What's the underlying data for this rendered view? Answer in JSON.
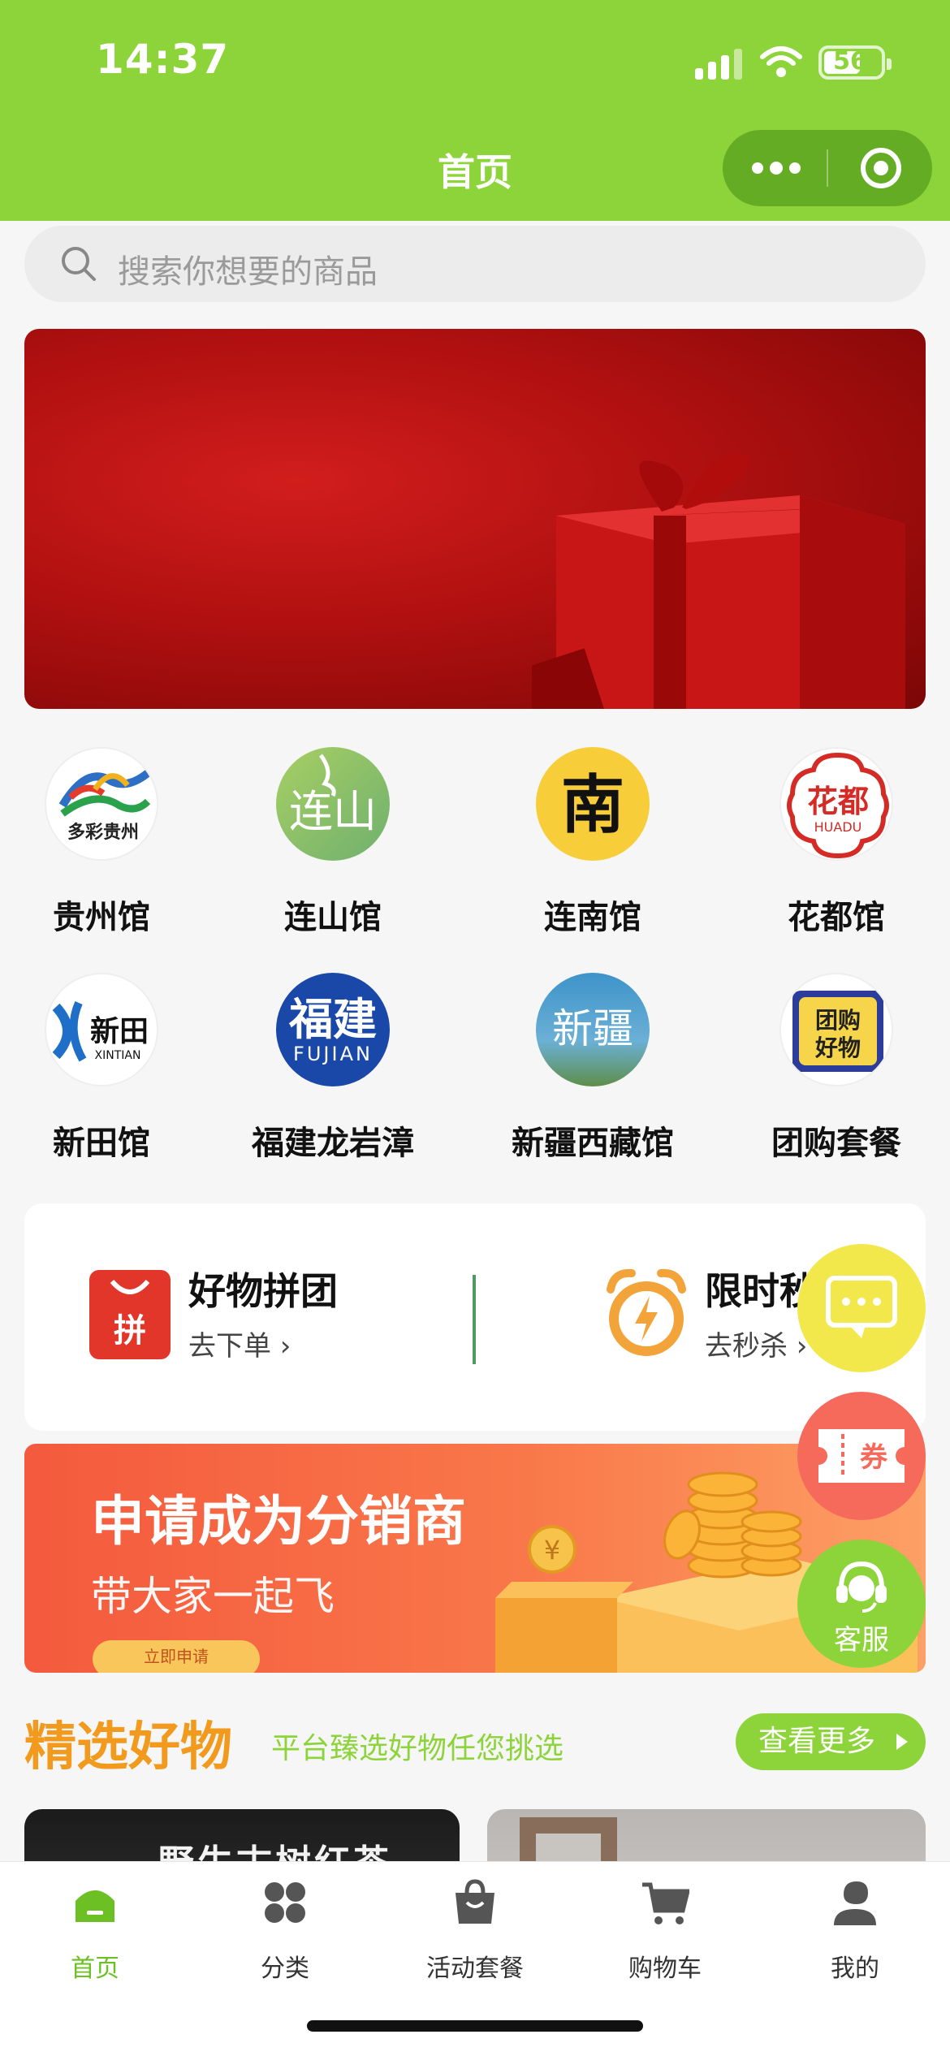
{
  "status": {
    "time": "14:37",
    "battery": "56"
  },
  "nav": {
    "title": "首页"
  },
  "search": {
    "placeholder": "搜索你想要的商品"
  },
  "banner": {
    "slide_count": 5,
    "active_index": 0
  },
  "categories": [
    {
      "label": "贵州馆",
      "logo_text": "多彩贵州"
    },
    {
      "label": "连山馆",
      "logo_text": "连山"
    },
    {
      "label": "连南馆",
      "logo_text": "南"
    },
    {
      "label": "花都馆",
      "logo_text": "花都",
      "logo_sub": "HUADU"
    },
    {
      "label": "新田馆",
      "logo_text": "新田",
      "logo_sub": "XINTIAN"
    },
    {
      "label": "福建龙岩漳",
      "logo_text": "福建",
      "logo_sub": "FUJIAN"
    },
    {
      "label": "新疆西藏馆",
      "logo_text": "新疆"
    },
    {
      "label": "团购套餐",
      "logo_text": "团购好物"
    }
  ],
  "promos": [
    {
      "title": "好物拼团",
      "sub": "去下单",
      "icon_text": "拼"
    },
    {
      "title": "限时秒",
      "sub": "去秒杀"
    }
  ],
  "distributor": {
    "title": "申请成为分销商",
    "sub": "带大家一起飞",
    "button": "立即申请"
  },
  "section": {
    "title": "精选好物",
    "sub": "平台臻选好物任您挑选",
    "more": "查看更多"
  },
  "products": [
    {
      "title": "野生古树红茶"
    },
    {
      "title": ""
    }
  ],
  "floating": {
    "coupon": "券",
    "service": "客服"
  },
  "tabs": [
    {
      "label": "首页",
      "icon": "home-icon",
      "active": true
    },
    {
      "label": "分类",
      "icon": "category-icon",
      "active": false
    },
    {
      "label": "活动套餐",
      "icon": "bag-icon",
      "active": false
    },
    {
      "label": "购物车",
      "icon": "cart-icon",
      "active": false
    },
    {
      "label": "我的",
      "icon": "user-icon",
      "active": false
    }
  ],
  "colors": {
    "brand": "#8dd33a",
    "accent": "#f29a1d",
    "promo": "#f45a3d"
  }
}
